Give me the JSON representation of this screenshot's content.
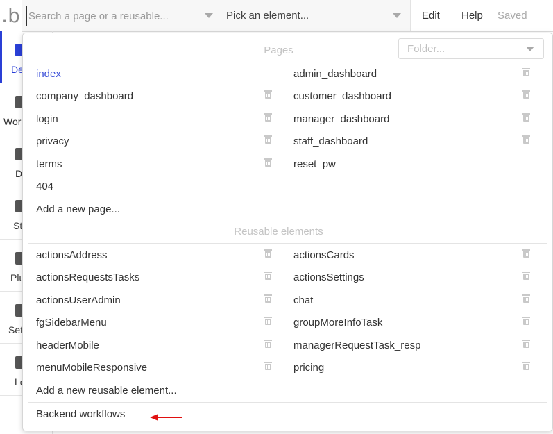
{
  "topbar": {
    "logo_text": "b",
    "search_placeholder": "Search a page or a reusable...",
    "element_picker": "Pick an element...",
    "menu": [
      "Edit",
      "Help"
    ],
    "status": "Saved"
  },
  "sidebar": {
    "items": [
      {
        "label": "De",
        "icon": "design-icon",
        "active": true
      },
      {
        "label": "Wor",
        "icon": "workflow-icon"
      },
      {
        "label": "D",
        "icon": "data-icon"
      },
      {
        "label": "St",
        "icon": "styles-icon"
      },
      {
        "label": "Plu",
        "icon": "plugins-icon"
      },
      {
        "label": "Set",
        "icon": "settings-icon"
      },
      {
        "label": "Lo",
        "icon": "logs-icon"
      }
    ]
  },
  "dropdown": {
    "folder_placeholder": "Folder...",
    "pages_title": "Pages",
    "pages_left": [
      "index",
      "company_dashboard",
      "login",
      "privacy",
      "terms",
      "404"
    ],
    "pages_right": [
      "admin_dashboard",
      "customer_dashboard",
      "manager_dashboard",
      "staff_dashboard",
      "reset_pw"
    ],
    "add_page": "Add a new page...",
    "reusable_title": "Reusable elements",
    "reusable_left": [
      "actionsAddress",
      "actionsRequestsTasks",
      "actionsUserAdmin",
      "fgSidebarMenu",
      "headerMobile",
      "menuMobileResponsive"
    ],
    "reusable_right": [
      "actionsCards",
      "actionsSettings",
      "chat",
      "groupMoreInfoTask",
      "managerRequestTask_resp",
      "pricing"
    ],
    "add_reusable": "Add a new reusable element...",
    "backend": "Backend workflows",
    "accent_color": "#3b4fd8",
    "annotation_arrow_color": "#e01010"
  }
}
